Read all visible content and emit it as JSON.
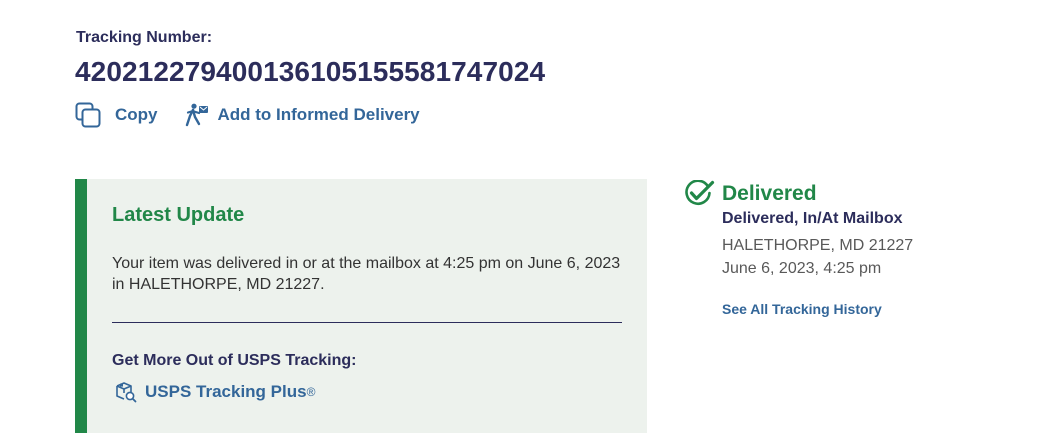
{
  "tracking": {
    "label": "Tracking Number:",
    "number": "420212279400136105155581747024"
  },
  "actions": {
    "copy_label": "Copy",
    "informed_label": "Add to Informed Delivery"
  },
  "latest_update": {
    "title": "Latest Update",
    "text": "Your item was delivered in or at the mailbox at 4:25 pm on June 6, 2023 in HALETHORPE, MD 21227.",
    "more_label": "Get More Out of USPS Tracking:",
    "plus_link": "USPS Tracking Plus",
    "plus_mark": "®"
  },
  "status": {
    "title": "Delivered",
    "detail": "Delivered, In/At Mailbox",
    "location": "HALETHORPE, MD 21227",
    "datetime": "June 6, 2023, 4:25 pm",
    "history_link": "See All Tracking History"
  },
  "icons": {
    "copy": "copy-icon",
    "informed": "mail-carrier-icon",
    "plus": "package-search-icon",
    "status": "check-circle-icon"
  },
  "colors": {
    "navy": "#2c2d5b",
    "green": "#218748",
    "link": "#336699",
    "panel_bg": "#edf2ed"
  }
}
